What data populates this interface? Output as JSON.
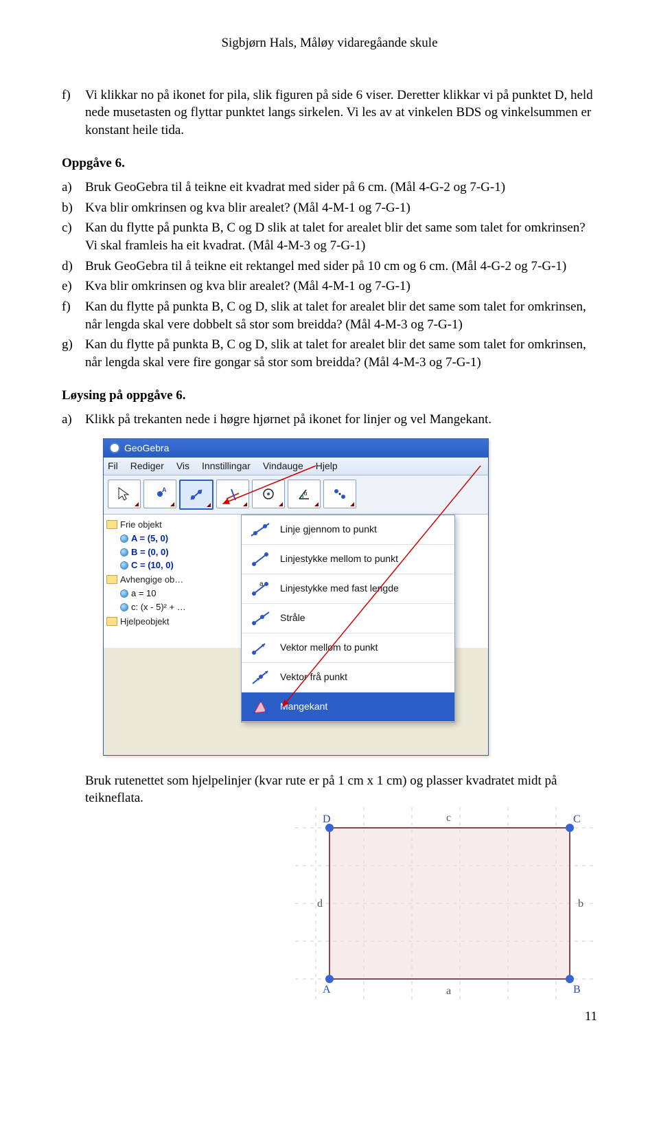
{
  "header": {
    "author_line": "Sigbjørn Hals, Måløy vidaregåande skule"
  },
  "intro": {
    "f_text": "Vi klikkar no på ikonet for pila, slik figuren på side 6 viser. Deretter klikkar vi på punktet D, held nede musetasten og flyttar punktet langs sirkelen. Vi les av at vinkelen BDS og vinkelsummen er konstant heile tida."
  },
  "task6": {
    "title": "Oppgåve 6.",
    "items": {
      "a": "Bruk GeoGebra til å teikne eit kvadrat med sider på 6 cm. (Mål 4-G-2 og 7-G-1)",
      "b": "Kva blir omkrinsen og kva blir arealet? (Mål 4-M-1 og 7-G-1)",
      "c": "Kan du flytte på punkta B, C og D slik at talet for arealet blir det same som talet for omkrinsen? Vi skal framleis ha eit kvadrat. (Mål 4-M-3 og 7-G-1)",
      "d": "Bruk GeoGebra til å teikne eit rektangel med sider på 10 cm og 6 cm. (Mål 4-G-2 og 7-G-1)",
      "e": "Kva blir omkrinsen og kva blir arealet? (Mål 4-M-1 og 7-G-1)",
      "f": "Kan du flytte på punkta B, C og D, slik at talet for arealet blir det same som talet for omkrinsen, når lengda skal vere dobbelt så stor som breidda? (Mål 4-M-3 og 7-G-1)",
      "g": "Kan du flytte på punkta B, C og D, slik at talet for arealet blir det same som talet for omkrinsen, når lengda skal vere fire gongar så stor som breidda? (Mål 4-M-3 og 7-G-1)"
    }
  },
  "solution": {
    "title": "Løysing på oppgåve 6.",
    "a_text": "Klikk på trekanten nede i høgre hjørnet på ikonet for linjer og vel Mangekant.",
    "after_fig": "Bruk rutenettet som hjelpelinjer (kvar rute er på 1 cm x 1 cm) og plasser kvadratet midt på teikneflata."
  },
  "geogebra": {
    "title": "GeoGebra",
    "menus": [
      "Fil",
      "Rediger",
      "Vis",
      "Innstillingar",
      "Vindauge",
      "Hjelp"
    ],
    "algebra": {
      "free_label": "Frie objekt",
      "free": [
        "A = (5, 0)",
        "B = (0, 0)",
        "C = (10, 0)"
      ],
      "dep_label": "Avhengige ob…",
      "dep": [
        "a = 10",
        "c: (x - 5)² + …"
      ],
      "help_label": "Hjelpeobjekt"
    },
    "dropdown": [
      "Linje gjennom to punkt",
      "Linjestykke mellom to punkt",
      "Linjestykke med fast lengde",
      "Stråle",
      "Vektor mellom to punkt",
      "Vektor frå punkt",
      "Mangekant"
    ]
  },
  "square": {
    "labels": {
      "A": "A",
      "B": "B",
      "C": "C",
      "D": "D",
      "a": "a",
      "b": "b",
      "c": "c",
      "d": "d"
    }
  },
  "page_number": "11"
}
